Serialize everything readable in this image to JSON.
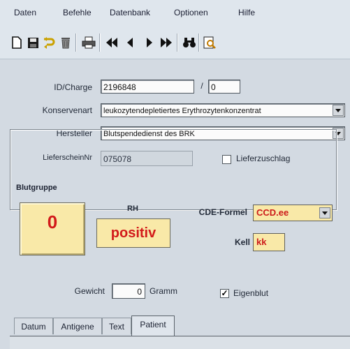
{
  "menu": {
    "items": [
      "Daten",
      "Befehle",
      "Datenbank",
      "Optionen",
      "Hilfe"
    ]
  },
  "toolbar": {
    "icons": [
      "new-document-icon",
      "save-icon",
      "undo-icon",
      "delete-icon",
      "print-icon",
      "first-record-icon",
      "previous-record-icon",
      "next-record-icon",
      "last-record-icon",
      "find-icon",
      "preview-icon"
    ]
  },
  "form": {
    "id_charge_label": "ID/Charge",
    "id_value": "2196848",
    "separator": "/",
    "charge_value": "0",
    "konservenart_label": "Konservenart",
    "konservenart_value": "leukozytendepletiertes Erythrozytenkonzentrat",
    "hersteller_label": "Hersteller",
    "hersteller_value": "Blutspendedienst des BRK",
    "lieferschein_label": "LieferscheinNr",
    "lieferschein_value": "075078",
    "lieferzuschlag_label": "Lieferzuschlag",
    "lieferzuschlag_checked": false
  },
  "blutgruppe": {
    "title": "Blutgruppe",
    "group_value": "0",
    "rh_label": "RH",
    "rh_value": "positiv",
    "cde_label": "CDE-Formel",
    "cde_value": "CCD.ee",
    "kell_label": "Kell",
    "kell_value": "kk"
  },
  "gewicht": {
    "label": "Gewicht",
    "value": "0",
    "unit": "Gramm",
    "eigenblut_label": "Eigenblut",
    "eigenblut_checked": true
  },
  "tabs": [
    "Datum",
    "Antigene",
    "Text",
    "Patient"
  ],
  "active_tab": "Patient",
  "colors": {
    "value_red": "#d21a1a",
    "value_bg_yellow": "#f9e9a8"
  }
}
